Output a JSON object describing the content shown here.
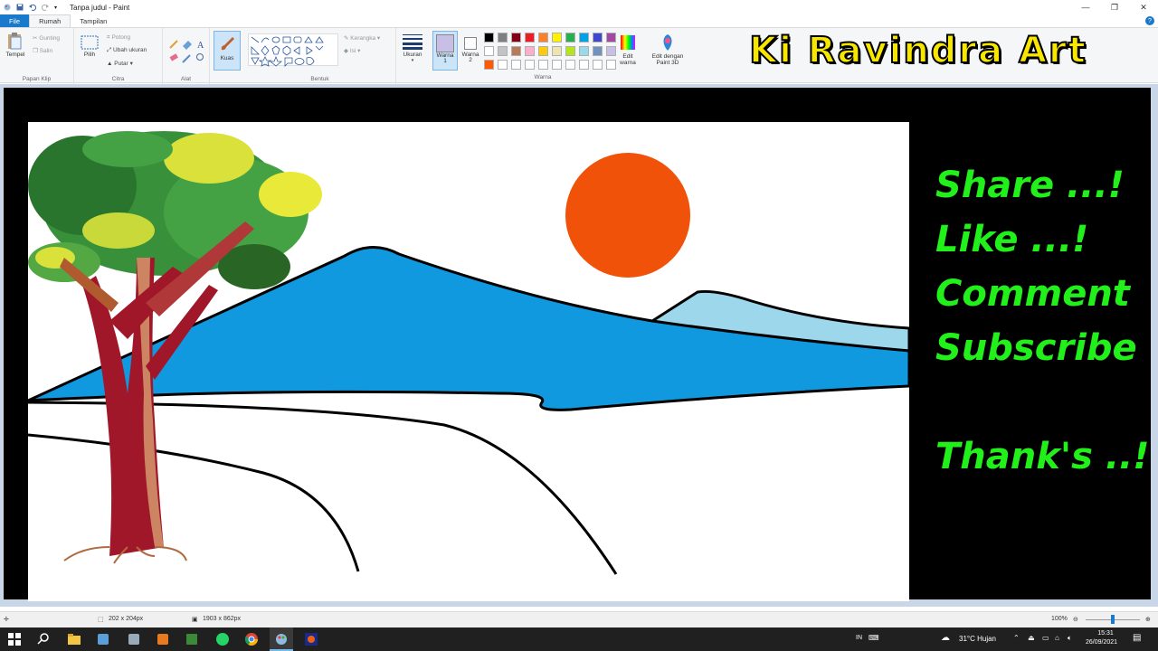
{
  "window": {
    "title": "Tanpa judul - Paint",
    "controls": [
      "—",
      "❐",
      "✕"
    ]
  },
  "tabs": [
    "File",
    "Rumah",
    "Tampilan"
  ],
  "ribbon": {
    "clipboard": {
      "paste": "Tempel",
      "cut": "Gunting",
      "copy": "Salin",
      "label": "Papan Klip"
    },
    "image": {
      "select": "Pilih",
      "crop": "Potong",
      "resize": "Ubah ukuran",
      "rotate": "Putar",
      "label": "Citra"
    },
    "tools": {
      "label": "Alat"
    },
    "brushes": {
      "label": "Kuas"
    },
    "shapes": {
      "outline": "Kerangka",
      "fill": "Isi",
      "label": "Bentuk"
    },
    "size": {
      "label": "Ukuran"
    },
    "color1": {
      "label": "Warna",
      "num": "1"
    },
    "color2": {
      "label": "Warna",
      "num": "2"
    },
    "colors": {
      "label": "Warna",
      "row1": [
        "#000000",
        "#7f7f7f",
        "#880015",
        "#ed1c24",
        "#ff7f27",
        "#fff200",
        "#22b14c",
        "#00a2e8",
        "#3f48cc",
        "#a349a4"
      ],
      "row2": [
        "#ffffff",
        "#c3c3c3",
        "#b97a57",
        "#ffaec9",
        "#ffc90e",
        "#efe4b0",
        "#b5e61d",
        "#99d9ea",
        "#7092be",
        "#c8bfe7"
      ],
      "row3": [
        "#ff5a00",
        "#ffffff",
        "#ffffff",
        "#ffffff",
        "#ffffff",
        "#ffffff",
        "#ffffff",
        "#ffffff",
        "#ffffff",
        "#ffffff"
      ]
    },
    "edit_colors": {
      "line1": "Edit",
      "line2": "warna"
    },
    "paint3d": {
      "line1": "Edit dengan",
      "line2": "Paint 3D"
    }
  },
  "overlay": {
    "brand": "Ki Ravindra Art",
    "lines": [
      "Share ...!",
      "Like ...!",
      "Comment",
      "Subscribe",
      "Thank's ..!"
    ]
  },
  "colors": {
    "brand_text": "#f7e600",
    "overlay_text": "#22f01a",
    "sun": "#f0520a",
    "mountain": "#1199e0",
    "mountain_far": "#9cd7ec"
  },
  "status": {
    "selection": "202 x 204px",
    "canvas_size": "1903 x 862px",
    "zoom": "100%"
  },
  "taskbar": {
    "weather": "31°C  Hujan",
    "lang": "IN",
    "time": "15:31",
    "date": "26/09/2021"
  }
}
